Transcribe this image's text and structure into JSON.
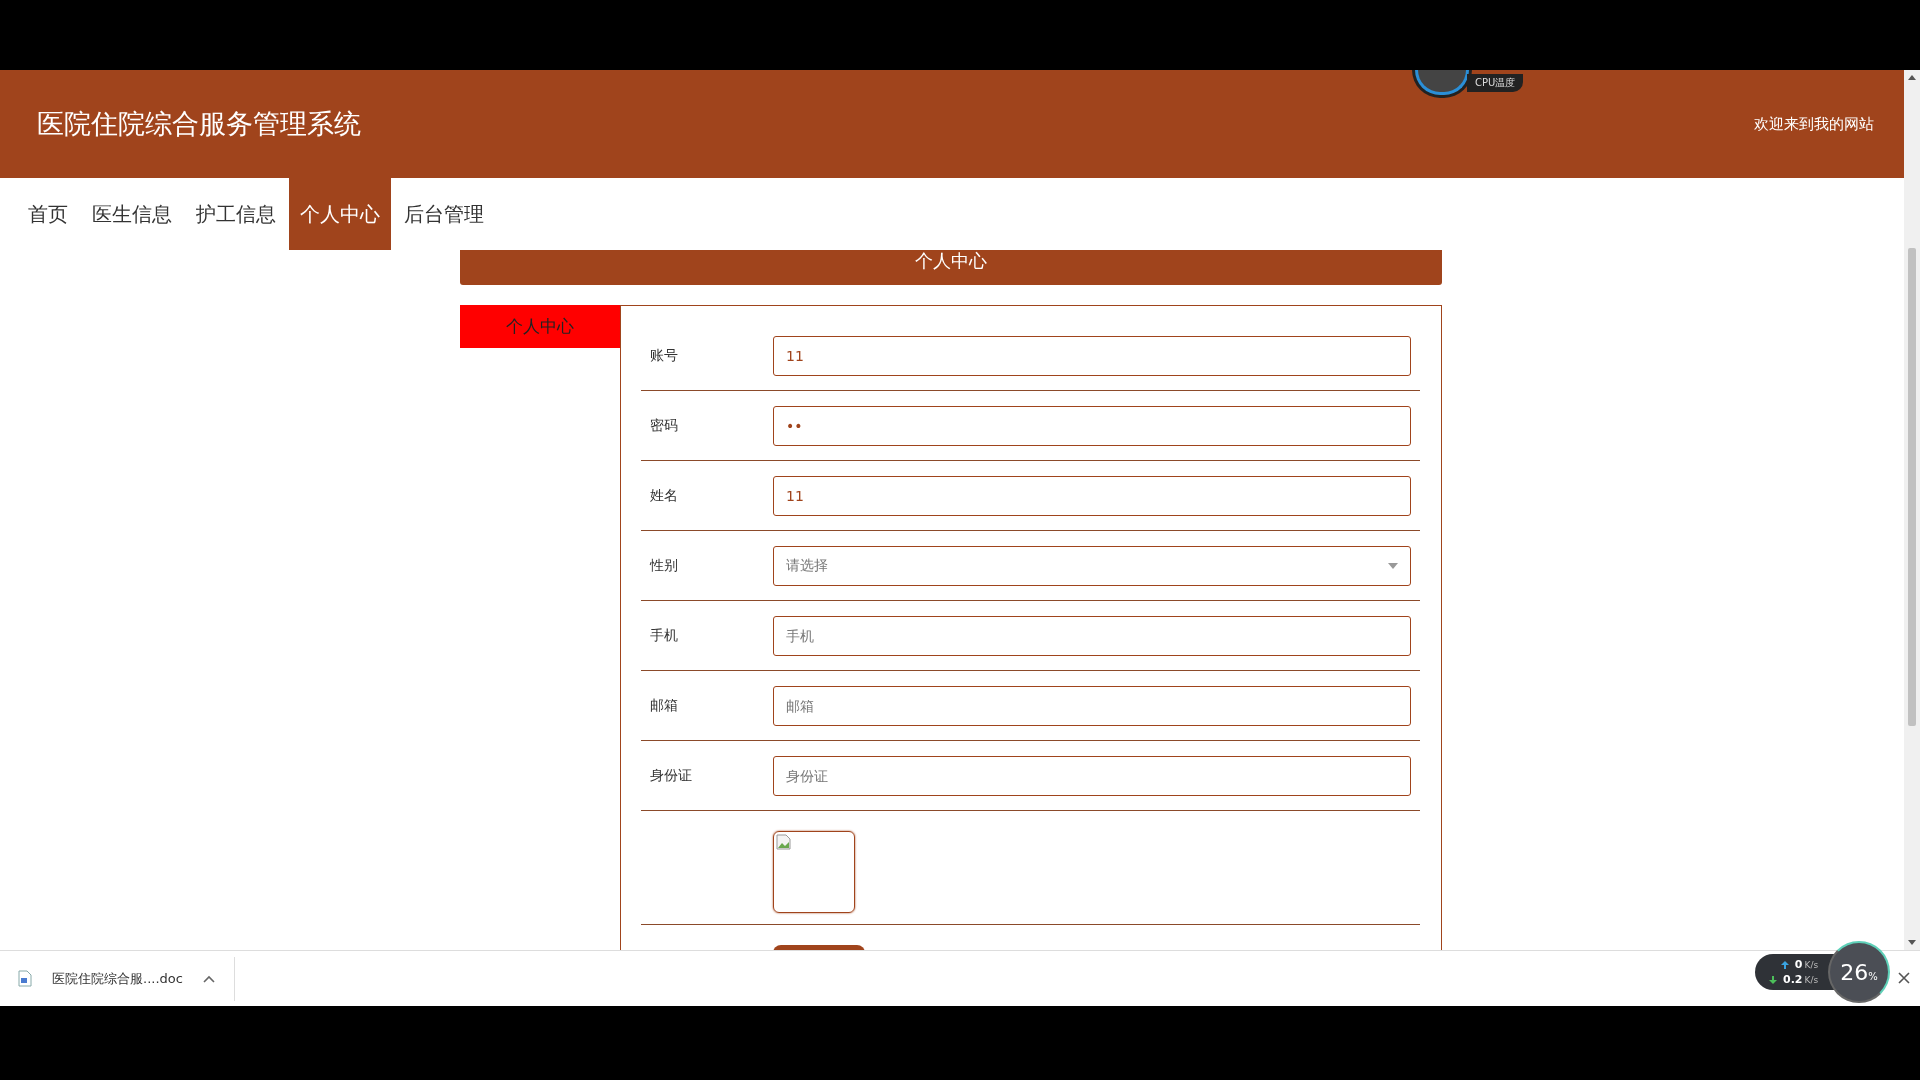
{
  "header": {
    "title": "医院住院综合服务管理系统",
    "welcome": "欢迎来到我的网站"
  },
  "cpu_widget": {
    "label": "CPU温度"
  },
  "nav": [
    {
      "label": "首页",
      "selected": false
    },
    {
      "label": "医生信息",
      "selected": false
    },
    {
      "label": "护工信息",
      "selected": false
    },
    {
      "label": "个人中心",
      "selected": true
    },
    {
      "label": "后台管理",
      "selected": false
    }
  ],
  "section_title": "个人中心",
  "side_menu": [
    {
      "label": "个人中心",
      "selected": true
    }
  ],
  "form": [
    {
      "kind": "text",
      "label": "账号",
      "value": "11"
    },
    {
      "kind": "password",
      "label": "密码",
      "value": "••"
    },
    {
      "kind": "text",
      "label": "姓名",
      "value": "11"
    },
    {
      "kind": "select",
      "label": "性别",
      "placeholder": "请选择"
    },
    {
      "kind": "text",
      "label": "手机",
      "placeholder": "手机"
    },
    {
      "kind": "text",
      "label": "邮箱",
      "placeholder": "邮箱"
    },
    {
      "kind": "text",
      "label": "身份证",
      "placeholder": "身份证"
    },
    {
      "kind": "image"
    }
  ],
  "download_bar": {
    "file": "医院住院综合服....doc"
  },
  "speed_widget": {
    "up": "0",
    "up_unit": "K/s",
    "down": "0.2",
    "down_unit": "K/s",
    "percent": "26",
    "percent_unit": "%"
  }
}
